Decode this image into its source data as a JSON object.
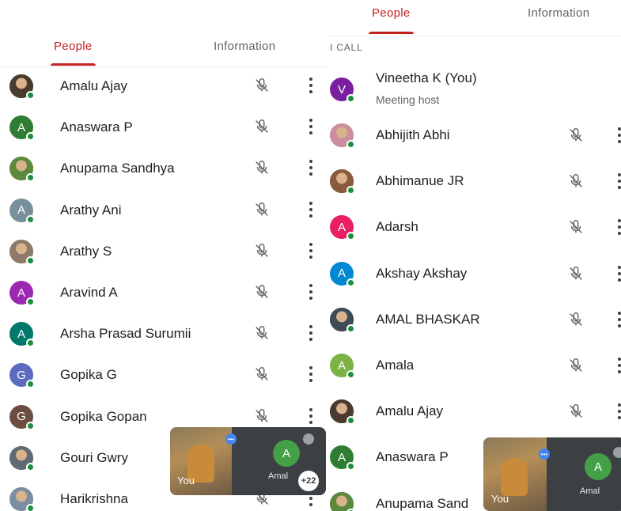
{
  "colors": {
    "accent": "#c5221f",
    "online": "#1e8e3e",
    "secondary_text": "#5f6368"
  },
  "left": {
    "tabs": [
      {
        "label": "People",
        "active": true
      },
      {
        "label": "Information",
        "active": false
      }
    ],
    "participants": [
      {
        "name": "Amalu Ajay",
        "initial": "",
        "avatar_color": "#4a3b2f"
      },
      {
        "name": "Anaswara P",
        "initial": "A",
        "avatar_color": "#2e7d32"
      },
      {
        "name": "Anupama Sandhya",
        "initial": "",
        "avatar_color": "#5b8a3c"
      },
      {
        "name": "Arathy Ani",
        "initial": "A",
        "avatar_color": "#78909c"
      },
      {
        "name": "Arathy S",
        "initial": "",
        "avatar_color": "#8d7a6b"
      },
      {
        "name": "Aravind A",
        "initial": "A",
        "avatar_color": "#9c27b0"
      },
      {
        "name": "Arsha Prasad Surumii",
        "initial": "A",
        "avatar_color": "#00796b"
      },
      {
        "name": "Gopika G",
        "initial": "G",
        "avatar_color": "#5c6bc0"
      },
      {
        "name": "Gopika Gopan",
        "initial": "G",
        "avatar_color": "#6d4c41"
      },
      {
        "name": "Gouri Gwry",
        "initial": "",
        "avatar_color": "#5f6b73"
      },
      {
        "name": "Harikrishna",
        "initial": "",
        "avatar_color": "#7b8ea0"
      }
    ],
    "pip": {
      "you_label": "You",
      "other_initial": "A",
      "other_label": "Amal",
      "count": "+22"
    }
  },
  "right": {
    "tabs": [
      {
        "label": "People",
        "active": true
      },
      {
        "label": "Information",
        "active": false
      }
    ],
    "section_label": "I CALL",
    "host": {
      "name": "Vineetha K (You)",
      "subtitle": "Meeting host",
      "initial": "V",
      "avatar_color": "#7b1fa2"
    },
    "participants": [
      {
        "name": "Abhijith Abhi",
        "initial": "",
        "avatar_color": "#c98fa0"
      },
      {
        "name": "Abhimanue JR",
        "initial": "",
        "avatar_color": "#8a5a3c"
      },
      {
        "name": "Adarsh",
        "initial": "A",
        "avatar_color": "#e91e63"
      },
      {
        "name": "Akshay Akshay",
        "initial": "A",
        "avatar_color": "#0288d1"
      },
      {
        "name": "AMAL BHASKAR",
        "initial": "",
        "avatar_color": "#3e4a55"
      },
      {
        "name": "Amala",
        "initial": "A",
        "avatar_color": "#7cb342"
      },
      {
        "name": "Amalu Ajay",
        "initial": "",
        "avatar_color": "#4a3b2f"
      },
      {
        "name": "Anaswara P",
        "initial": "A",
        "avatar_color": "#2e7d32"
      },
      {
        "name": "Anupama Sand",
        "initial": "",
        "avatar_color": "#5b8a3c"
      }
    ],
    "pip": {
      "you_label": "You",
      "other_initial": "A",
      "other_label": "Amal"
    }
  }
}
